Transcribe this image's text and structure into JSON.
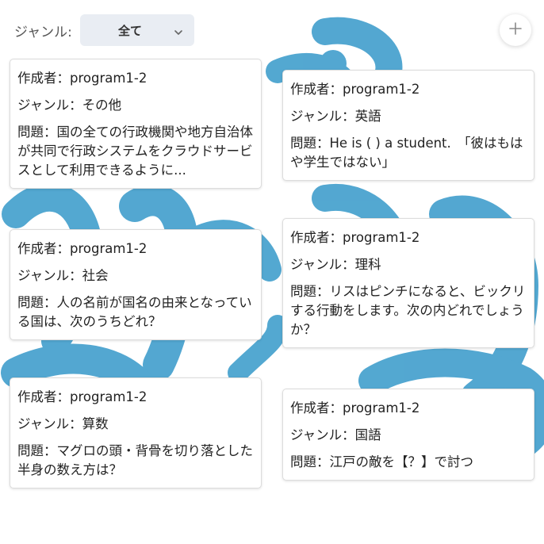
{
  "filter": {
    "label": "ジャンル:",
    "selected": "全て",
    "chevron_icon": "chevron-down-icon"
  },
  "add_button": {
    "icon": "plus-icon"
  },
  "colors": {
    "accent_blue": "#4aa3cf",
    "select_bg": "#e9edf3"
  },
  "cards": [
    {
      "author_label": "作成者：program1-2",
      "genre_label": "ジャンル：その他",
      "question": "問題：国の全ての行政機関や地方自治体が共同で行政システムをクラウドサービスとして利用できるように..."
    },
    {
      "author_label": "作成者：program1-2",
      "genre_label": "ジャンル：英語",
      "question": "問題：He is ( ) a student.　「彼はもはや学生ではない」"
    },
    {
      "author_label": "作成者：program1-2",
      "genre_label": "ジャンル：社会",
      "question": "問題：人の名前が国名の由来となっている国は、次のうちどれ？"
    },
    {
      "author_label": "作成者：program1-2",
      "genre_label": "ジャンル：理科",
      "question": "問題：リスはピンチになると、ビックリする行動をします。次の内どれでしょうか？"
    },
    {
      "author_label": "作成者：program1-2",
      "genre_label": "ジャンル：算数",
      "question": "問題：マグロの頭・背骨を切り落とした半身の数え方は？"
    },
    {
      "author_label": "作成者：program1-2",
      "genre_label": "ジャンル：国語",
      "question": "問題：江戸の敵を【？】で討つ"
    }
  ]
}
